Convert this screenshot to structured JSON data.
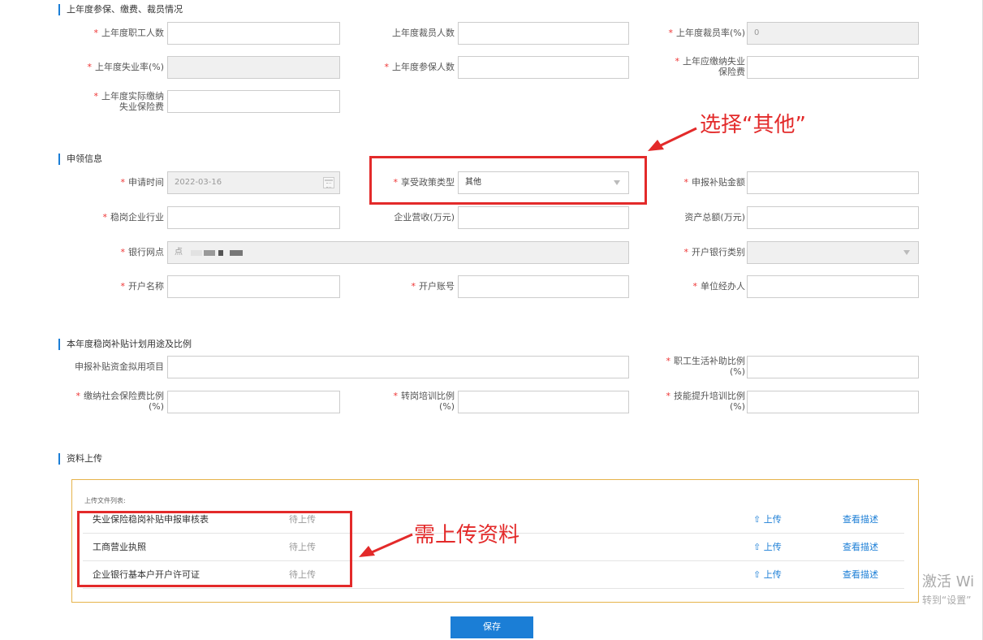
{
  "sections": {
    "insurance": "上年度参保、缴费、裁员情况",
    "claim": "申领信息",
    "plan": "本年度稳岗补贴计划用途及比例",
    "upload": "资料上传"
  },
  "insurance": {
    "employees_label": "上年度职工人数",
    "layoffs_label": "上年度裁员人数",
    "layoff_rate_label": "上年度裁员率(%)",
    "layoff_rate_value": "0",
    "unemployment_rate_label": "上年度失业率(%)",
    "insured_label": "上年度参保人数",
    "payable_label_1": "上年应缴纳失业",
    "payable_label_2": "保险费",
    "actual_label_1": "上年度实际缴纳",
    "actual_label_2": "失业保险费"
  },
  "claim": {
    "apply_date_label": "申请时间",
    "apply_date_value": "2022-03-16",
    "policy_type_label": "享受政策类型",
    "policy_type_value": "其他",
    "amount_label": "申报补贴金额",
    "industry_label": "稳岗企业行业",
    "revenue_label": "企业营收(万元)",
    "assets_label": "资产总额(万元)",
    "branch_label": "银行网点",
    "branch_value": "点",
    "bank_type_label": "开户银行类别",
    "account_name_label": "开户名称",
    "account_no_label": "开户账号",
    "handler_label": "单位经办人"
  },
  "plan": {
    "project_label": "申报补贴资金拟用项目",
    "living_label_1": "职工生活补助比例",
    "living_label_2": "(%)",
    "social_label_1": "缴纳社会保险费比例",
    "social_label_2": "(%)",
    "transfer_label_1": "转岗培训比例",
    "transfer_label_2": "(%)",
    "skill_label_1": "技能提升培训比例",
    "skill_label_2": "(%)"
  },
  "upload": {
    "list_title": "上传文件列表:",
    "files": [
      {
        "name": "失业保险稳岗补贴申报审核表",
        "status": "待上传",
        "upload": "上传",
        "desc": "查看描述"
      },
      {
        "name": "工商营业执照",
        "status": "待上传",
        "upload": "上传",
        "desc": "查看描述"
      },
      {
        "name": "企业银行基本户开户许可证",
        "status": "待上传",
        "upload": "上传",
        "desc": "查看描述"
      }
    ]
  },
  "annotations": {
    "select_other": "选择“其他”",
    "need_upload": "需上传资料"
  },
  "save_label": "保存",
  "watermark": {
    "line1": "激活 Wi",
    "line2": "转到“设置”"
  },
  "colors": {
    "accent": "#1b7ed6",
    "annotation": "#e32a2a",
    "required": "#ee3333",
    "upload_border": "#e6b34a"
  }
}
